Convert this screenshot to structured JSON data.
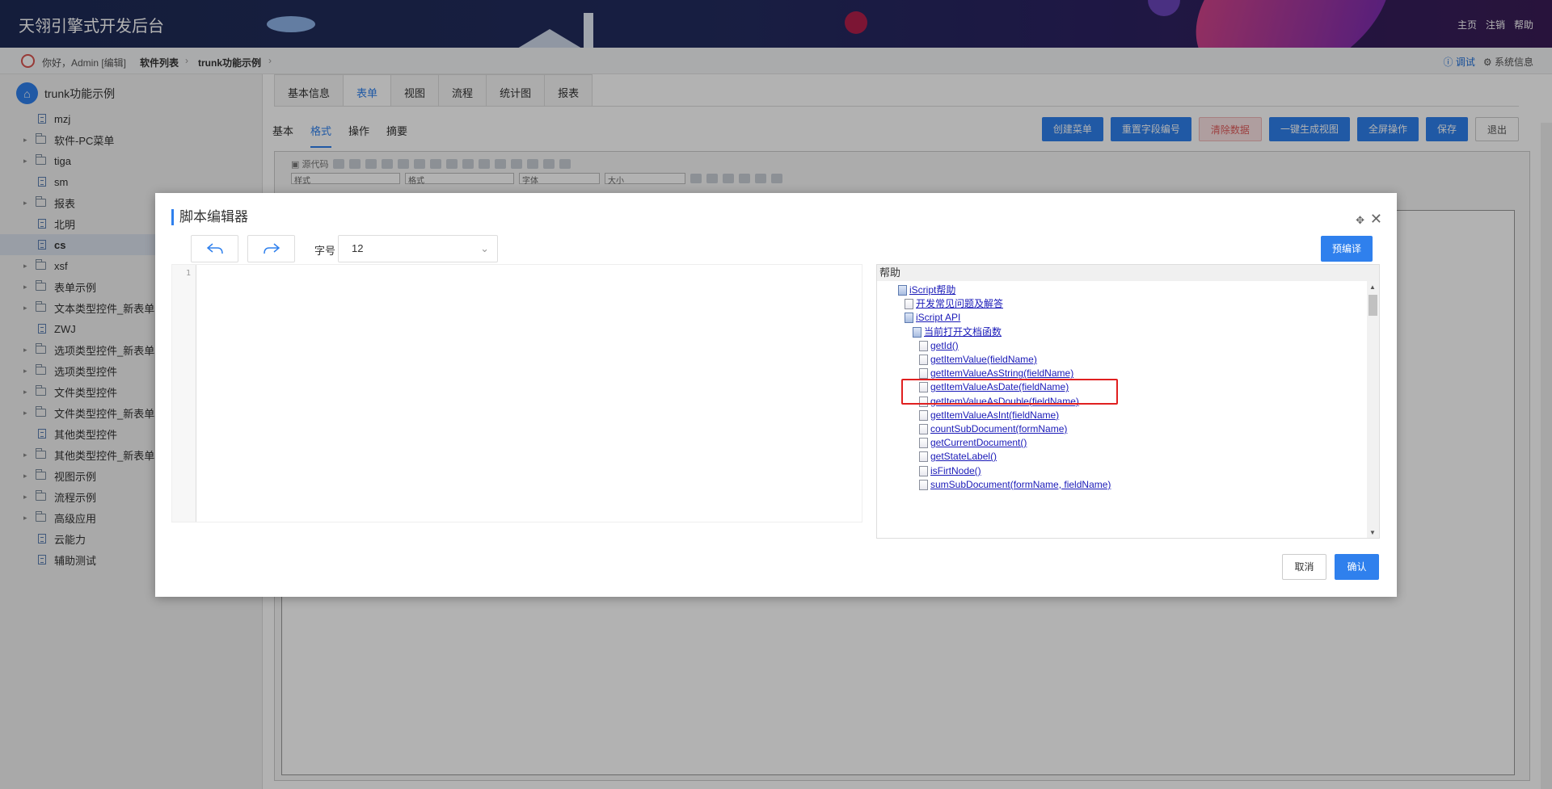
{
  "header": {
    "app_title": "天翎引擎式开发后台",
    "links": [
      "主页",
      "注销",
      "帮助"
    ]
  },
  "breadcrumb": {
    "greeting": "你好，Admin [编辑]",
    "items": [
      "软件列表",
      "trunk功能示例"
    ],
    "right_links": [
      "调试",
      "系统信息"
    ]
  },
  "sidebar": {
    "root": "trunk功能示例",
    "items": [
      {
        "label": "mzj",
        "type": "doc",
        "expandable": false
      },
      {
        "label": "软件-PC菜单",
        "type": "folder",
        "expandable": true
      },
      {
        "label": "tiga",
        "type": "folder",
        "expandable": true
      },
      {
        "label": "sm",
        "type": "doc",
        "expandable": false
      },
      {
        "label": "报表",
        "type": "folder",
        "expandable": true
      },
      {
        "label": "北明",
        "type": "doc",
        "expandable": false
      },
      {
        "label": "cs",
        "type": "doc",
        "expandable": false,
        "selected": true
      },
      {
        "label": "xsf",
        "type": "folder",
        "expandable": true
      },
      {
        "label": "表单示例",
        "type": "folder",
        "expandable": true
      },
      {
        "label": "文本类型控件_新表单",
        "type": "folder",
        "expandable": true
      },
      {
        "label": "ZWJ",
        "type": "doc",
        "expandable": false
      },
      {
        "label": "选项类型控件_新表单",
        "type": "folder",
        "expandable": true
      },
      {
        "label": "选项类型控件",
        "type": "folder",
        "expandable": true
      },
      {
        "label": "文件类型控件",
        "type": "folder",
        "expandable": true
      },
      {
        "label": "文件类型控件_新表单",
        "type": "folder",
        "expandable": true
      },
      {
        "label": "其他类型控件",
        "type": "doc",
        "expandable": false
      },
      {
        "label": "其他类型控件_新表单",
        "type": "folder",
        "expandable": true
      },
      {
        "label": "视图示例",
        "type": "folder",
        "expandable": true
      },
      {
        "label": "流程示例",
        "type": "folder",
        "expandable": true
      },
      {
        "label": "高级应用",
        "type": "folder",
        "expandable": true
      },
      {
        "label": "云能力",
        "type": "doc",
        "expandable": false
      },
      {
        "label": "辅助测试",
        "type": "doc",
        "expandable": false
      }
    ]
  },
  "main": {
    "tabs": [
      "基本信息",
      "表单",
      "视图",
      "流程",
      "统计图",
      "报表"
    ],
    "active_tab": "表单",
    "subtabs": [
      "基本",
      "格式",
      "操作",
      "摘要"
    ],
    "active_subtab": "格式",
    "actions": [
      "创建菜单",
      "重置字段编号",
      "清除数据",
      "一键生成视图",
      "全屏操作",
      "保存",
      "退出"
    ],
    "toolbar": {
      "source_label": "源代码",
      "style_label": "样式",
      "format_label": "格式",
      "font_label": "字体",
      "size_label": "大小"
    }
  },
  "modal": {
    "title": "脚本编辑器",
    "font_size_label": "字号",
    "font_size_value": "12",
    "precompile_label": "预编译",
    "line_number": "1",
    "help_title": "帮助",
    "help_items": [
      {
        "label": "iScript帮助",
        "level": 0,
        "icon": "book"
      },
      {
        "label": "开发常见问题及解答",
        "level": 1,
        "icon": "page"
      },
      {
        "label": "iScript API",
        "level": 1,
        "icon": "book"
      },
      {
        "label": "当前打开文档函数",
        "level": 2,
        "icon": "book"
      },
      {
        "label": "getId()",
        "level": 3,
        "icon": "page"
      },
      {
        "label": "getItemValue(fieldName)",
        "level": 3,
        "icon": "page"
      },
      {
        "label": "getItemValueAsString(fieldName)",
        "level": 3,
        "icon": "page",
        "highlighted": true
      },
      {
        "label": "getItemValueAsDate(fieldName)",
        "level": 3,
        "icon": "page"
      },
      {
        "label": "getItemValueAsDouble(fieldName)",
        "level": 3,
        "icon": "page"
      },
      {
        "label": "getItemValueAsInt(fieldName)",
        "level": 3,
        "icon": "page"
      },
      {
        "label": "countSubDocument(formName)",
        "level": 3,
        "icon": "page"
      },
      {
        "label": "getCurrentDocument()",
        "level": 3,
        "icon": "page"
      },
      {
        "label": "getStateLabel()",
        "level": 3,
        "icon": "page"
      },
      {
        "label": "isFirtNode()",
        "level": 3,
        "icon": "page"
      },
      {
        "label": "sumSubDocument(formName, fieldName)",
        "level": 3,
        "icon": "page"
      }
    ],
    "cancel_label": "取消",
    "ok_label": "确认"
  },
  "colors": {
    "accent": "#2f80ed",
    "highlight_box": "#e02020",
    "header_bg": "#1e2a55"
  }
}
